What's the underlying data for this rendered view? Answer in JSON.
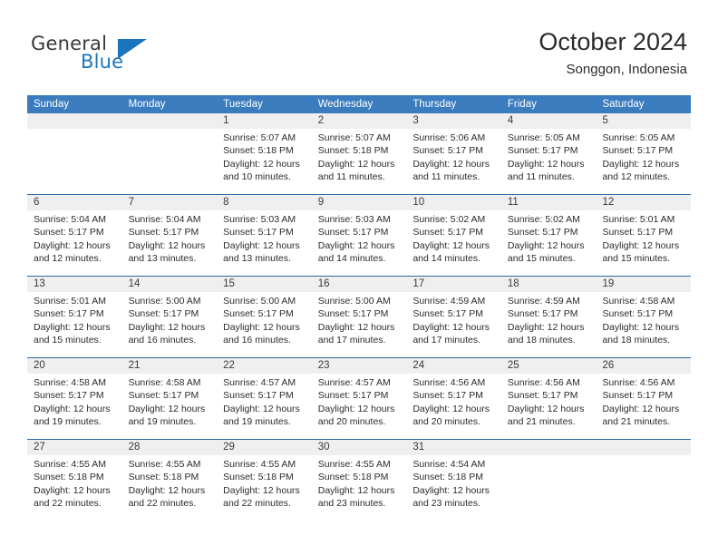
{
  "brand": {
    "name_part1": "General",
    "name_part2": "Blue"
  },
  "header": {
    "title": "October 2024",
    "subtitle": "Songgon, Indonesia"
  },
  "calendar": {
    "weekday_headers": [
      "Sunday",
      "Monday",
      "Tuesday",
      "Wednesday",
      "Thursday",
      "Friday",
      "Saturday"
    ],
    "colors": {
      "header_bar": "#3a7cbe",
      "row_divider": "#2c6aa8",
      "number_band": "#efefef",
      "brand_blue": "#1b75bc"
    },
    "weeks": [
      [
        {
          "day": "",
          "lines": []
        },
        {
          "day": "",
          "lines": []
        },
        {
          "day": "1",
          "lines": [
            "Sunrise: 5:07 AM",
            "Sunset: 5:18 PM",
            "Daylight: 12 hours",
            "and 10 minutes."
          ]
        },
        {
          "day": "2",
          "lines": [
            "Sunrise: 5:07 AM",
            "Sunset: 5:18 PM",
            "Daylight: 12 hours",
            "and 11 minutes."
          ]
        },
        {
          "day": "3",
          "lines": [
            "Sunrise: 5:06 AM",
            "Sunset: 5:17 PM",
            "Daylight: 12 hours",
            "and 11 minutes."
          ]
        },
        {
          "day": "4",
          "lines": [
            "Sunrise: 5:05 AM",
            "Sunset: 5:17 PM",
            "Daylight: 12 hours",
            "and 11 minutes."
          ]
        },
        {
          "day": "5",
          "lines": [
            "Sunrise: 5:05 AM",
            "Sunset: 5:17 PM",
            "Daylight: 12 hours",
            "and 12 minutes."
          ]
        }
      ],
      [
        {
          "day": "6",
          "lines": [
            "Sunrise: 5:04 AM",
            "Sunset: 5:17 PM",
            "Daylight: 12 hours",
            "and 12 minutes."
          ]
        },
        {
          "day": "7",
          "lines": [
            "Sunrise: 5:04 AM",
            "Sunset: 5:17 PM",
            "Daylight: 12 hours",
            "and 13 minutes."
          ]
        },
        {
          "day": "8",
          "lines": [
            "Sunrise: 5:03 AM",
            "Sunset: 5:17 PM",
            "Daylight: 12 hours",
            "and 13 minutes."
          ]
        },
        {
          "day": "9",
          "lines": [
            "Sunrise: 5:03 AM",
            "Sunset: 5:17 PM",
            "Daylight: 12 hours",
            "and 14 minutes."
          ]
        },
        {
          "day": "10",
          "lines": [
            "Sunrise: 5:02 AM",
            "Sunset: 5:17 PM",
            "Daylight: 12 hours",
            "and 14 minutes."
          ]
        },
        {
          "day": "11",
          "lines": [
            "Sunrise: 5:02 AM",
            "Sunset: 5:17 PM",
            "Daylight: 12 hours",
            "and 15 minutes."
          ]
        },
        {
          "day": "12",
          "lines": [
            "Sunrise: 5:01 AM",
            "Sunset: 5:17 PM",
            "Daylight: 12 hours",
            "and 15 minutes."
          ]
        }
      ],
      [
        {
          "day": "13",
          "lines": [
            "Sunrise: 5:01 AM",
            "Sunset: 5:17 PM",
            "Daylight: 12 hours",
            "and 15 minutes."
          ]
        },
        {
          "day": "14",
          "lines": [
            "Sunrise: 5:00 AM",
            "Sunset: 5:17 PM",
            "Daylight: 12 hours",
            "and 16 minutes."
          ]
        },
        {
          "day": "15",
          "lines": [
            "Sunrise: 5:00 AM",
            "Sunset: 5:17 PM",
            "Daylight: 12 hours",
            "and 16 minutes."
          ]
        },
        {
          "day": "16",
          "lines": [
            "Sunrise: 5:00 AM",
            "Sunset: 5:17 PM",
            "Daylight: 12 hours",
            "and 17 minutes."
          ]
        },
        {
          "day": "17",
          "lines": [
            "Sunrise: 4:59 AM",
            "Sunset: 5:17 PM",
            "Daylight: 12 hours",
            "and 17 minutes."
          ]
        },
        {
          "day": "18",
          "lines": [
            "Sunrise: 4:59 AM",
            "Sunset: 5:17 PM",
            "Daylight: 12 hours",
            "and 18 minutes."
          ]
        },
        {
          "day": "19",
          "lines": [
            "Sunrise: 4:58 AM",
            "Sunset: 5:17 PM",
            "Daylight: 12 hours",
            "and 18 minutes."
          ]
        }
      ],
      [
        {
          "day": "20",
          "lines": [
            "Sunrise: 4:58 AM",
            "Sunset: 5:17 PM",
            "Daylight: 12 hours",
            "and 19 minutes."
          ]
        },
        {
          "day": "21",
          "lines": [
            "Sunrise: 4:58 AM",
            "Sunset: 5:17 PM",
            "Daylight: 12 hours",
            "and 19 minutes."
          ]
        },
        {
          "day": "22",
          "lines": [
            "Sunrise: 4:57 AM",
            "Sunset: 5:17 PM",
            "Daylight: 12 hours",
            "and 19 minutes."
          ]
        },
        {
          "day": "23",
          "lines": [
            "Sunrise: 4:57 AM",
            "Sunset: 5:17 PM",
            "Daylight: 12 hours",
            "and 20 minutes."
          ]
        },
        {
          "day": "24",
          "lines": [
            "Sunrise: 4:56 AM",
            "Sunset: 5:17 PM",
            "Daylight: 12 hours",
            "and 20 minutes."
          ]
        },
        {
          "day": "25",
          "lines": [
            "Sunrise: 4:56 AM",
            "Sunset: 5:17 PM",
            "Daylight: 12 hours",
            "and 21 minutes."
          ]
        },
        {
          "day": "26",
          "lines": [
            "Sunrise: 4:56 AM",
            "Sunset: 5:17 PM",
            "Daylight: 12 hours",
            "and 21 minutes."
          ]
        }
      ],
      [
        {
          "day": "27",
          "lines": [
            "Sunrise: 4:55 AM",
            "Sunset: 5:18 PM",
            "Daylight: 12 hours",
            "and 22 minutes."
          ]
        },
        {
          "day": "28",
          "lines": [
            "Sunrise: 4:55 AM",
            "Sunset: 5:18 PM",
            "Daylight: 12 hours",
            "and 22 minutes."
          ]
        },
        {
          "day": "29",
          "lines": [
            "Sunrise: 4:55 AM",
            "Sunset: 5:18 PM",
            "Daylight: 12 hours",
            "and 22 minutes."
          ]
        },
        {
          "day": "30",
          "lines": [
            "Sunrise: 4:55 AM",
            "Sunset: 5:18 PM",
            "Daylight: 12 hours",
            "and 23 minutes."
          ]
        },
        {
          "day": "31",
          "lines": [
            "Sunrise: 4:54 AM",
            "Sunset: 5:18 PM",
            "Daylight: 12 hours",
            "and 23 minutes."
          ]
        },
        {
          "day": "",
          "lines": []
        },
        {
          "day": "",
          "lines": []
        }
      ]
    ]
  }
}
